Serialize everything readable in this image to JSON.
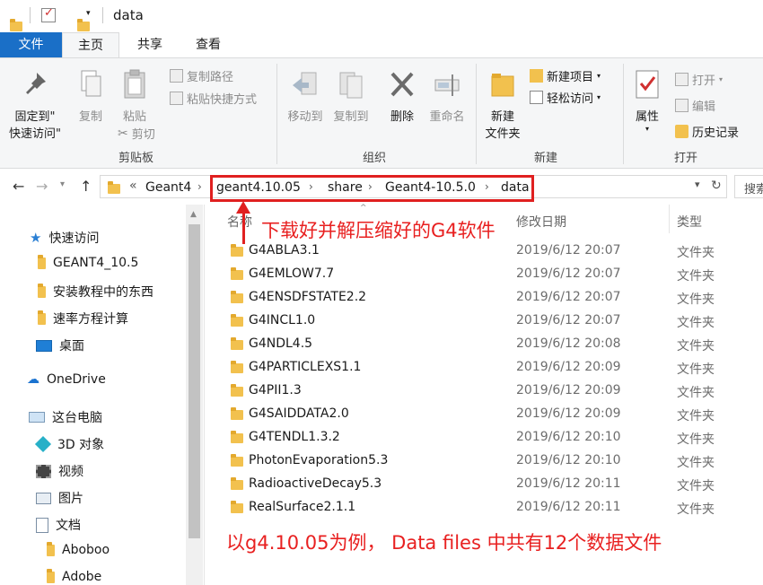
{
  "window": {
    "title": "data"
  },
  "tabs": {
    "file": "文件",
    "home": "主页",
    "share": "共享",
    "view": "查看"
  },
  "ribbon": {
    "pin": "固定到\"\n快速访问\"",
    "pin_line1": "固定到\"",
    "pin_line2": "快速访问\"",
    "copy": "复制",
    "paste": "粘贴",
    "copy_path": "复制路径",
    "paste_shortcut": "粘贴快捷方式",
    "cut": "剪切",
    "clipboard_group": "剪贴板",
    "move_to": "移动到",
    "copy_to": "复制到",
    "delete": "删除",
    "rename": "重命名",
    "organize_group": "组织",
    "new_folder_line1": "新建",
    "new_folder_line2": "文件夹",
    "new_item": "新建项目",
    "easy_access": "轻松访问",
    "new_group": "新建",
    "properties": "属性",
    "open": "打开",
    "edit": "编辑",
    "history": "历史记录",
    "open_group": "打开"
  },
  "address": {
    "crumbs": [
      "Geant4",
      "geant4.10.05",
      "share",
      "Geant4-10.5.0",
      "data"
    ],
    "overflow": "«",
    "search_placeholder": "搜索"
  },
  "nav": {
    "quick_access": "快速访问",
    "pinned": [
      "GEANT4_10.5",
      "安装教程中的东西",
      "速率方程计算"
    ],
    "desktop": "桌面",
    "onedrive": "OneDrive",
    "this_pc": "这台电脑",
    "pc_items": [
      "3D 对象",
      "视频",
      "图片",
      "文档"
    ],
    "doc_items": [
      "Aboboo",
      "Adobe"
    ]
  },
  "columns": {
    "name": "名称",
    "date": "修改日期",
    "type": "类型"
  },
  "files": [
    {
      "name": "G4ABLA3.1",
      "date": "2019/6/12 20:07",
      "type": "文件夹"
    },
    {
      "name": "G4EMLOW7.7",
      "date": "2019/6/12 20:07",
      "type": "文件夹"
    },
    {
      "name": "G4ENSDFSTATE2.2",
      "date": "2019/6/12 20:07",
      "type": "文件夹"
    },
    {
      "name": "G4INCL1.0",
      "date": "2019/6/12 20:07",
      "type": "文件夹"
    },
    {
      "name": "G4NDL4.5",
      "date": "2019/6/12 20:08",
      "type": "文件夹"
    },
    {
      "name": "G4PARTICLEXS1.1",
      "date": "2019/6/12 20:09",
      "type": "文件夹"
    },
    {
      "name": "G4PII1.3",
      "date": "2019/6/12 20:09",
      "type": "文件夹"
    },
    {
      "name": "G4SAIDDATA2.0",
      "date": "2019/6/12 20:09",
      "type": "文件夹"
    },
    {
      "name": "G4TENDL1.3.2",
      "date": "2019/6/12 20:10",
      "type": "文件夹"
    },
    {
      "name": "PhotonEvaporation5.3",
      "date": "2019/6/12 20:10",
      "type": "文件夹"
    },
    {
      "name": "RadioactiveDecay5.3",
      "date": "2019/6/12 20:11",
      "type": "文件夹"
    },
    {
      "name": "RealSurface2.1.1",
      "date": "2019/6/12 20:11",
      "type": "文件夹"
    }
  ],
  "annotations": {
    "top": "下载好并解压缩好的G4软件",
    "bottom": "以g4.10.05为例， Data files  中共有12个数据文件"
  },
  "colors": {
    "accent": "#1a6fc7",
    "annotation": "#e82020",
    "folder": "#f2c14e"
  }
}
